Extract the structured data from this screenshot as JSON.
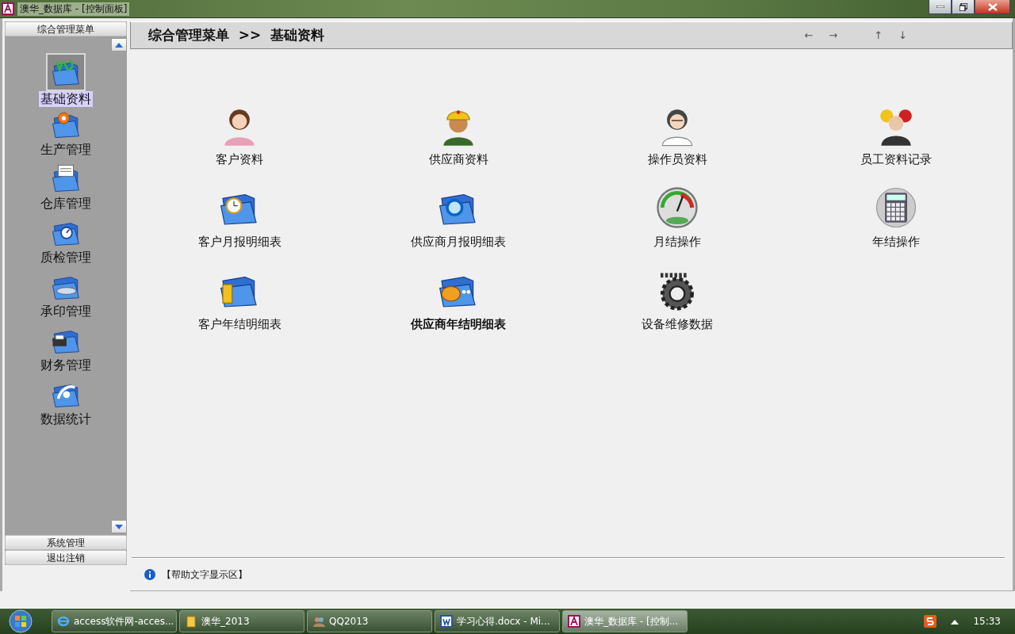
{
  "window": {
    "title": "澳华_数据库 - [控制面板]"
  },
  "sidebar": {
    "header": "综合管理菜单",
    "items": [
      {
        "label": "基础资料",
        "selected": true
      },
      {
        "label": "生产管理",
        "selected": false
      },
      {
        "label": "仓库管理",
        "selected": false
      },
      {
        "label": "质检管理",
        "selected": false
      },
      {
        "label": "承印管理",
        "selected": false
      },
      {
        "label": "财务管理",
        "selected": false
      },
      {
        "label": "数据统计",
        "selected": false
      }
    ],
    "footer_buttons": [
      "系统管理",
      "退出注销"
    ]
  },
  "breadcrumb": {
    "text": "综合管理菜单  >>  基础资料",
    "nav": [
      "←",
      "→",
      "↑",
      "↓"
    ]
  },
  "tiles": [
    {
      "label": "客户资料",
      "highlighted": false
    },
    {
      "label": "供应商资料",
      "highlighted": false
    },
    {
      "label": "操作员资料",
      "highlighted": false
    },
    {
      "label": "员工资料记录",
      "highlighted": false
    },
    {
      "label": "客户月报明细表",
      "highlighted": false
    },
    {
      "label": "供应商月报明细表",
      "highlighted": false
    },
    {
      "label": "月结操作",
      "highlighted": false
    },
    {
      "label": "年结操作",
      "highlighted": false
    },
    {
      "label": "客户年结明细表",
      "highlighted": false
    },
    {
      "label": "供应商年结明细表",
      "highlighted": true
    },
    {
      "label": "设备维修数据",
      "highlighted": false
    }
  ],
  "help_text": "【帮助文字显示区】",
  "taskbar": {
    "items": [
      {
        "label": "access软件网-acces...",
        "selected": false
      },
      {
        "label": "澳华_2013",
        "selected": false
      },
      {
        "label": "QQ2013",
        "selected": false
      },
      {
        "label": "学习心得.docx - Mi...",
        "selected": false
      },
      {
        "label": "澳华_数据库 - [控制...",
        "selected": true
      }
    ],
    "clock": "15:33"
  }
}
